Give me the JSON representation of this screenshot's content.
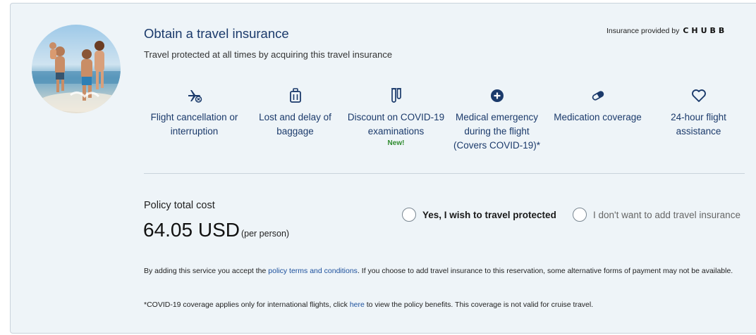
{
  "header": {
    "title": "Obtain a travel insurance",
    "subtitle": "Travel protected at all times by acquiring this travel insurance",
    "provider_prefix": "Insurance provided by",
    "provider_brand": "CHUBB"
  },
  "benefits": [
    {
      "icon": "plane-cancel-icon",
      "label": "Flight cancellation or interruption",
      "badge": ""
    },
    {
      "icon": "luggage-icon",
      "label": "Lost and delay of baggage",
      "badge": ""
    },
    {
      "icon": "test-tubes-icon",
      "label": "Discount on COVID-19 examinations",
      "badge": "New!"
    },
    {
      "icon": "medical-plus-icon",
      "label": "Medical emergency during the flight (Covers COVID-19)*",
      "badge": ""
    },
    {
      "icon": "pill-icon",
      "label": "Medication coverage",
      "badge": ""
    },
    {
      "icon": "heart-icon",
      "label": "24-hour flight assistance",
      "badge": ""
    }
  ],
  "cost": {
    "label": "Policy total cost",
    "amount": "64.05 USD",
    "per": "(per person)"
  },
  "options": {
    "yes": "Yes, I wish to travel protected",
    "no": "I don't want to add travel insurance"
  },
  "fine_print": {
    "terms_prefix": "By adding this service you accept the",
    "terms_link": "policy terms and conditions",
    "terms_suffix": ".  If you choose to add travel insurance to this reservation, some alternative forms of payment may not be available.",
    "covid_prefix": "*COVID-19 coverage applies only for international flights, click",
    "covid_link": "here",
    "covid_suffix": "to view the policy benefits. This coverage is not valid for cruise travel."
  },
  "colors": {
    "accent": "#1b3a6b",
    "link": "#1b4f9c",
    "new_badge": "#2e8b2e",
    "card_bg": "#eef4f8"
  }
}
